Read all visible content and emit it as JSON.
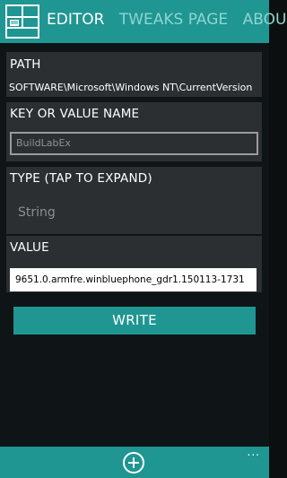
{
  "header": {
    "tabs": [
      {
        "label": "EDITOR"
      },
      {
        "label": "TWEAKS PAGE"
      },
      {
        "label": "ABOU"
      }
    ]
  },
  "path": {
    "label": "PATH",
    "value": "SOFTWARE\\Microsoft\\Windows NT\\CurrentVersion"
  },
  "key": {
    "label": "KEY OR VALUE NAME",
    "value": "BuildLabEx"
  },
  "type": {
    "label": "TYPE (TAP TO EXPAND)",
    "value": "String"
  },
  "value_field": {
    "label": "VALUE",
    "value": "9651.0.armfre.winbluephone_gdr1.150113-1731"
  },
  "actions": {
    "write_label": "WRITE"
  },
  "appbar": {
    "more_label": "..."
  },
  "colors": {
    "accent": "#1f9692",
    "panel": "#2b2f31",
    "background": "#0f1416"
  },
  "icons": {
    "logo": "app-logo-icon",
    "add": "add-circle-icon"
  }
}
